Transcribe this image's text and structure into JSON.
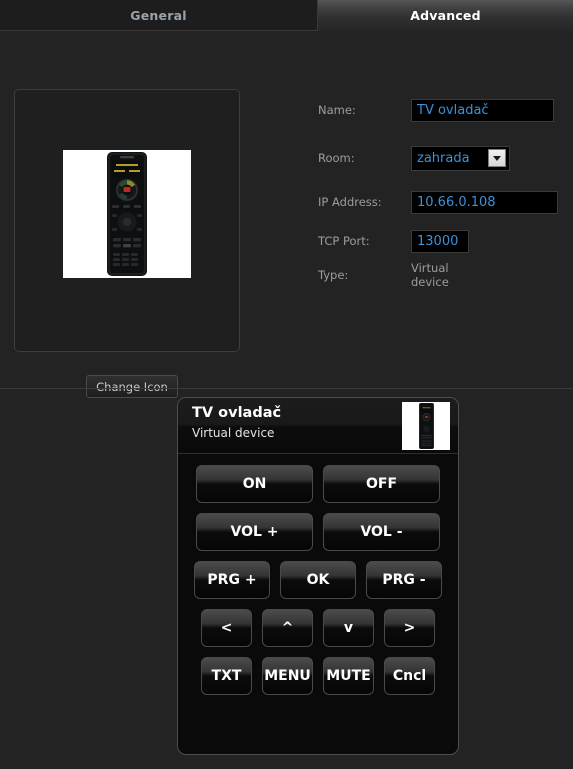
{
  "tabs": [
    {
      "label": "General",
      "active": false
    },
    {
      "label": "Advanced",
      "active": true
    }
  ],
  "icon_panel": {
    "image_alt": "remote-control-photo",
    "change_button": "Change Icon"
  },
  "form": {
    "name": {
      "label": "Name:",
      "value": "TV ovladač"
    },
    "room": {
      "label": "Room:",
      "value": "zahrada"
    },
    "ip_address": {
      "label": "IP Address:",
      "value": "10.66.0.108"
    },
    "tcp_port": {
      "label": "TCP Port:",
      "value": "13000"
    },
    "type": {
      "label": "Type:",
      "value": "Virtual device"
    }
  },
  "remote_panel": {
    "title": "TV ovladač",
    "subtitle": "Virtual device",
    "thumbnail_alt": "remote-control-photo",
    "rows": [
      {
        "buttons": [
          {
            "label": "ON"
          },
          {
            "label": "OFF"
          }
        ]
      },
      {
        "buttons": [
          {
            "label": "VOL +"
          },
          {
            "label": "VOL -"
          }
        ]
      },
      {
        "buttons": [
          {
            "label": "PRG +"
          },
          {
            "label": "OK"
          },
          {
            "label": "PRG -"
          }
        ]
      },
      {
        "buttons": [
          {
            "label": "<"
          },
          {
            "label": "^"
          },
          {
            "label": "v"
          },
          {
            "label": ">"
          }
        ]
      },
      {
        "buttons": [
          {
            "label": "TXT"
          },
          {
            "label": "MENU"
          },
          {
            "label": "MUTE"
          },
          {
            "label": "Cncl"
          }
        ]
      }
    ]
  },
  "colors": {
    "page_background": "#232323",
    "panel_background": "#0a0a0a",
    "input_background": "#000000",
    "input_text": "#3e90d8",
    "label_text": "#9d9d9d",
    "active_tab_text": "#ffffff",
    "inactive_tab_text": "#9aa3ac"
  }
}
